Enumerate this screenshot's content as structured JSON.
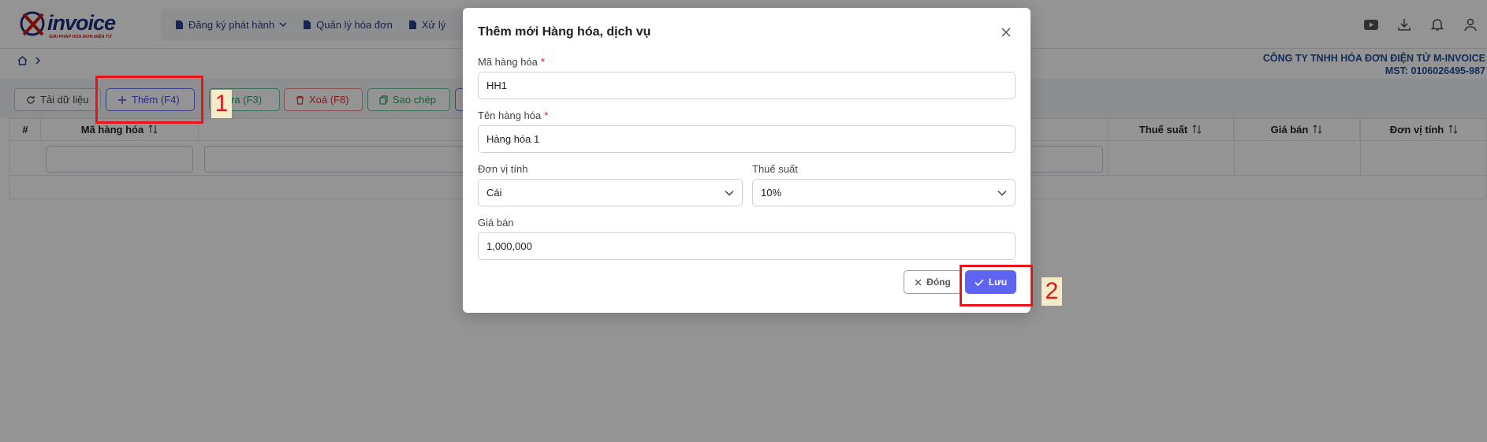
{
  "brand": {
    "logo_text": "invoice",
    "logo_sub": "GIẢI PHÁP HÓA ĐƠN ĐIỆN TỬ",
    "colors": {
      "primary": "#1b2f7a",
      "accent": "#5f64f0",
      "danger": "#e8141b"
    }
  },
  "menu": {
    "items": [
      {
        "label": "Đăng ký phát hành",
        "icon": "document-icon"
      },
      {
        "label": "Quản lý hóa đơn",
        "icon": "document-icon"
      },
      {
        "label": "Xử lý",
        "icon": "document-icon"
      }
    ]
  },
  "top_icons": [
    "youtube-icon",
    "download-icon",
    "bell-icon",
    "user-icon"
  ],
  "company": {
    "name": "CÔNG TY TNHH HÓA ĐƠN ĐIỆN TỬ M-INVOICE",
    "tax": "MST: 0106026495-987"
  },
  "toolbar": {
    "refresh": "Tải dữ liệu",
    "add": "Thêm (F4)",
    "edit": "Sửa (F3)",
    "delete": "Xoá (F8)",
    "copy": "Sao chép"
  },
  "table": {
    "columns": [
      "#",
      "Mã hàng hóa",
      "Thuế suất",
      "Giá bán",
      "Đơn vị tính"
    ]
  },
  "annotations": {
    "one": "1",
    "two": "2"
  },
  "modal": {
    "title": "Thêm mới Hàng hóa, dịch vụ",
    "fields": {
      "code": {
        "label": "Mã hàng hóa",
        "required": "*",
        "value": "HH1"
      },
      "name": {
        "label": "Tên hàng hóa",
        "required": "*",
        "value": "Hàng hóa 1"
      },
      "unit": {
        "label": "Đơn vị tính",
        "value": "Cái"
      },
      "tax": {
        "label": "Thuế suất",
        "value": "10%"
      },
      "price": {
        "label": "Giá bán",
        "value": "1,000,000"
      }
    },
    "buttons": {
      "close": "Đóng",
      "save": "Lưu"
    }
  }
}
